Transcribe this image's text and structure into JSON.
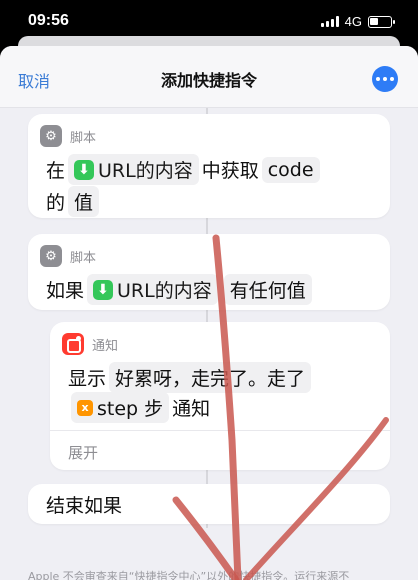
{
  "status": {
    "time": "09:56",
    "network": "4G"
  },
  "header": {
    "cancel": "取消",
    "title": "添加快捷指令"
  },
  "cards": {
    "script1": {
      "caption": "脚本",
      "w1": "在",
      "var": "URL的内容",
      "w2": "中获取",
      "key": "code",
      "w3": "的",
      "w4": "值"
    },
    "script2": {
      "caption": "脚本",
      "w1": "如果",
      "var": "URL的内容",
      "cond": "有任何值"
    },
    "notify": {
      "caption": "通知",
      "w1": "显示",
      "text1": "好累呀，走完了。走了",
      "var": "step 步",
      "w2": "通知",
      "expand": "展开"
    },
    "endif": {
      "label": "结束如果"
    }
  },
  "footer": {
    "text": "Apple 不会审查来自“快捷指令中心”以外的快捷指令。运行来源不"
  },
  "colors": {
    "accent": "#2e7cf6",
    "link": "#3a7bd5",
    "var_green": "#34c759",
    "notify_red": "#ff3b30",
    "step_orange": "#ff9500"
  }
}
